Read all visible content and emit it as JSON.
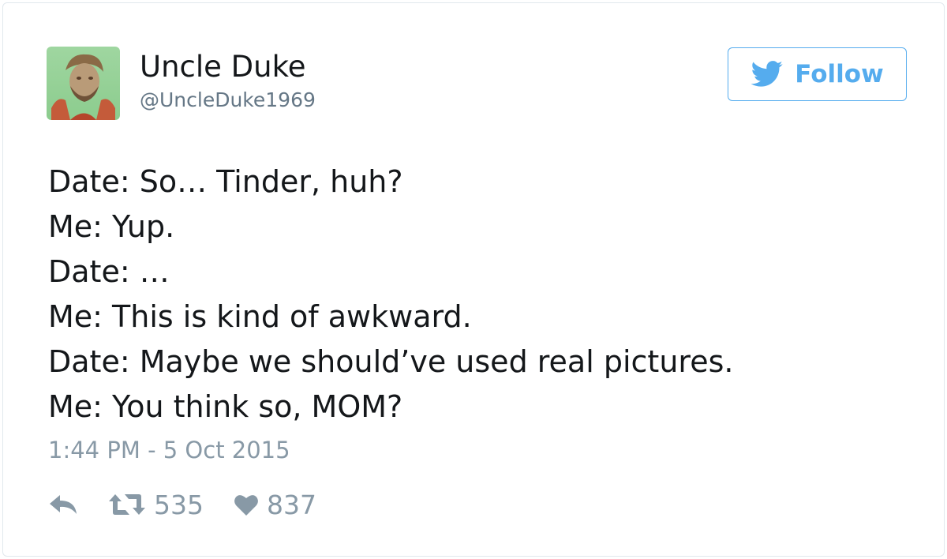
{
  "user": {
    "display_name": "Uncle Duke",
    "handle": "@UncleDuke1969",
    "avatar_icon": "profile-photo"
  },
  "follow_button": {
    "label": "Follow",
    "icon": "twitter-bird-icon",
    "color": "#55acee"
  },
  "tweet": {
    "lines": [
      "Date: So… Tinder, huh?",
      "Me: Yup.",
      "Date: …",
      "Me: This is kind of awkward.",
      "Date: Maybe we should’ve used real pictures.",
      "Me: You think so, MOM?"
    ],
    "timestamp": "1:44 PM - 5 Oct 2015"
  },
  "actions": {
    "reply_icon": "reply-icon",
    "retweet_icon": "retweet-icon",
    "retweet_count": "535",
    "like_icon": "heart-icon",
    "like_count": "837"
  },
  "colors": {
    "text_primary": "#14171a",
    "text_secondary": "#657786",
    "text_muted": "#8899a6",
    "accent": "#55acee",
    "border": "#e1e8ed"
  }
}
